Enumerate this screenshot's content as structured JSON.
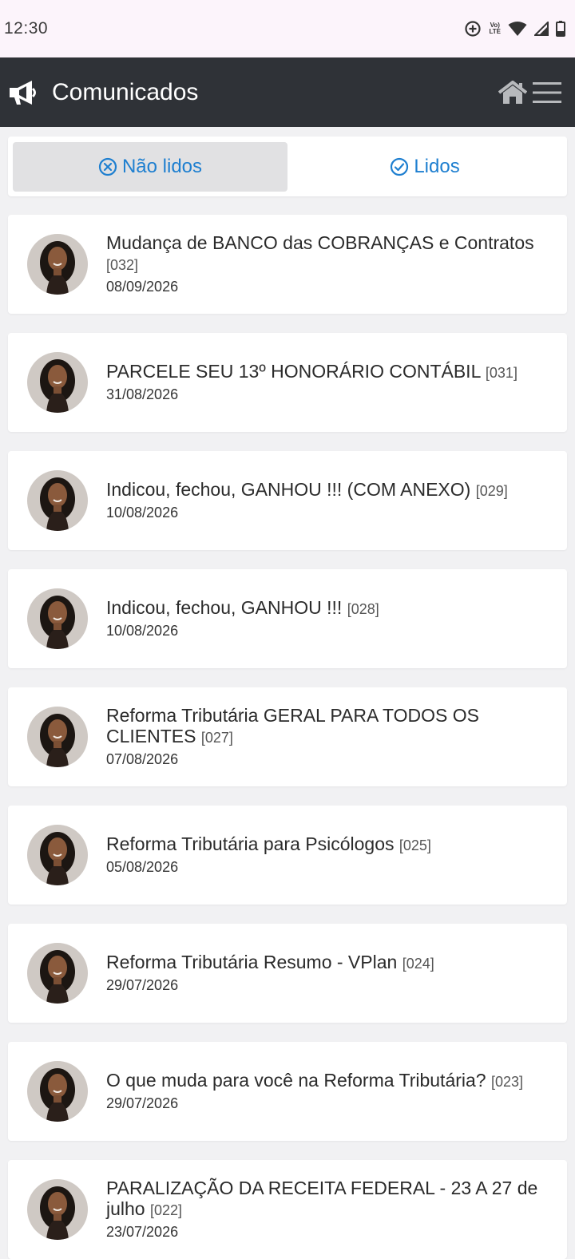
{
  "status_bar": {
    "time": "12:30",
    "volte": "Vo LTE"
  },
  "app_bar": {
    "title": "Comunicados",
    "icons": [
      "megaphone-icon",
      "home-icon",
      "menu-icon"
    ]
  },
  "tabs": [
    {
      "label": "Não lidos",
      "icon": "x-circle-icon",
      "active": true
    },
    {
      "label": "Lidos",
      "icon": "check-circle-icon",
      "active": false
    }
  ],
  "colors": {
    "app_bar": "#2f3237",
    "accent": "#1e7fd0",
    "active_tab": "#e1e1e3",
    "background": "#f1f1f3"
  },
  "announcements": [
    {
      "title": "Mudança de BANCO das COBRANÇAS e Contratos",
      "code": "[032]",
      "date": "08/09/2026"
    },
    {
      "title": "PARCELE SEU 13º HONORÁRIO CONTÁBIL",
      "code": "[031]",
      "date": "31/08/2026"
    },
    {
      "title": "Indicou, fechou, GANHOU !!! (COM ANEXO)",
      "code": "[029]",
      "date": "10/08/2026"
    },
    {
      "title": "Indicou, fechou, GANHOU !!!",
      "code": "[028]",
      "date": "10/08/2026"
    },
    {
      "title": "Reforma Tributária GERAL PARA TODOS OS CLIENTES",
      "code": "[027]",
      "date": "07/08/2026"
    },
    {
      "title": "Reforma Tributária para Psicólogos",
      "code": "[025]",
      "date": "05/08/2026"
    },
    {
      "title": "Reforma Tributária Resumo - VPlan",
      "code": "[024]",
      "date": "29/07/2026"
    },
    {
      "title": "O que muda para você na Reforma Tributária?",
      "code": "[023]",
      "date": "29/07/2026"
    },
    {
      "title": "PARALIZAÇÃO DA RECEITA FEDERAL - 23 A 27 de julho",
      "code": "[022]",
      "date": "23/07/2026"
    }
  ]
}
